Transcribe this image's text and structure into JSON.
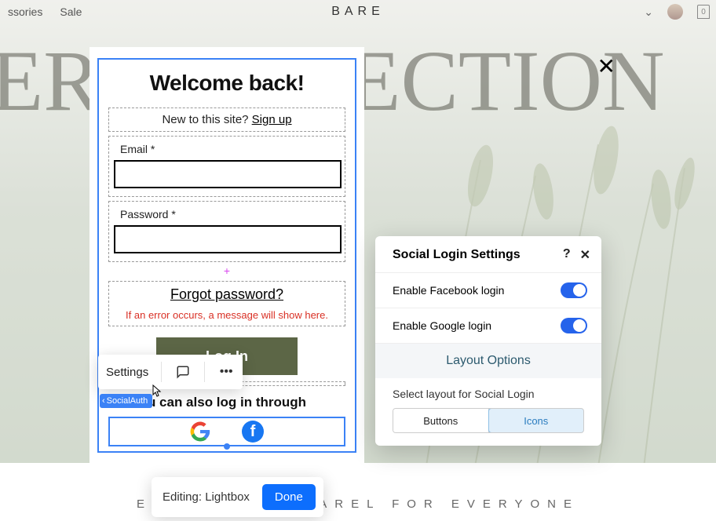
{
  "nav": {
    "left": [
      "ssories",
      "Sale"
    ],
    "brand": "BARE",
    "bag_count": "0"
  },
  "hero": "ER COLLECTION",
  "tagline": "EVERYDAY APPAREL FOR EVERYONE",
  "modal": {
    "title": "Welcome back!",
    "new_prompt": "New to this site? ",
    "signup": "Sign up",
    "email_label": "Email *",
    "password_label": "Password *",
    "forgot": "Forgot password?",
    "error": "If an error occurs, a message will show here.",
    "login": "Log In",
    "alt": "u can also log in through"
  },
  "ctx": {
    "settings": "Settings"
  },
  "tag": "SocialAuth",
  "panel": {
    "title": "Social Login Settings",
    "fb": "Enable Facebook login",
    "google": "Enable Google login",
    "layout_header": "Layout Options",
    "layout_sub": "Select layout for Social Login",
    "seg_a": "Buttons",
    "seg_b": "Icons"
  },
  "editbar": {
    "text": "Editing: Lightbox",
    "done": "Done"
  }
}
